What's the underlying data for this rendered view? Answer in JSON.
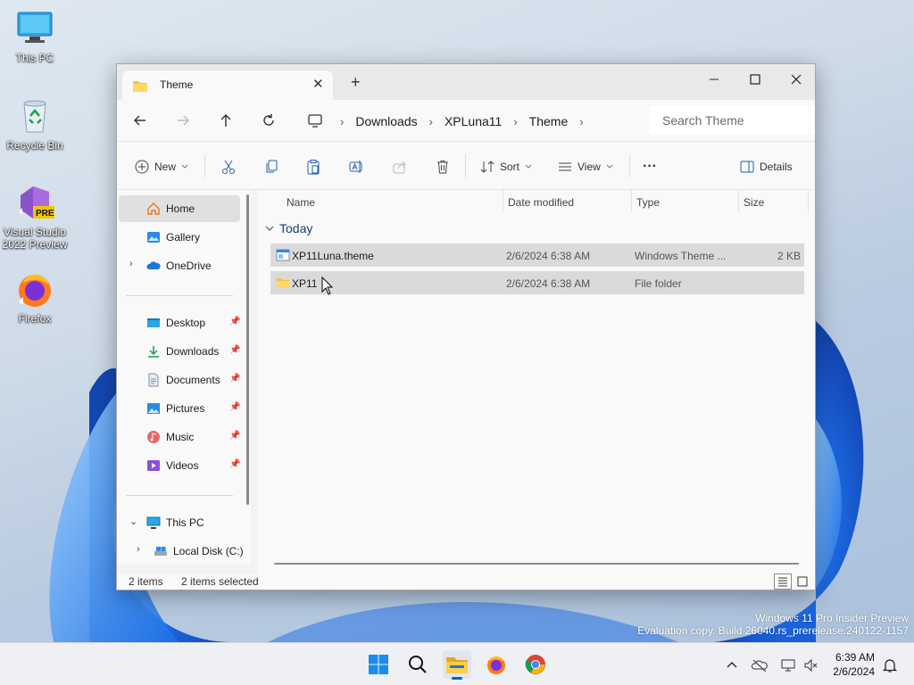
{
  "desktop": {
    "icons": [
      {
        "label": "This PC"
      },
      {
        "label": "Recycle Bin"
      },
      {
        "label": "Visual Studio 2022 Preview"
      },
      {
        "label": "Firefox"
      }
    ],
    "vs_badge": "PRE"
  },
  "window": {
    "tab_title": "Theme",
    "tab_close": "✕",
    "new_tab": "+",
    "controls": {
      "minimize": "—",
      "maximize": "☐",
      "close": "✕"
    },
    "address": {
      "crumbs": [
        "Downloads",
        "XPLuna11",
        "Theme"
      ],
      "search_placeholder": "Search Theme"
    },
    "toolbar": {
      "new_label": "New",
      "sort_label": "Sort",
      "view_label": "View",
      "more_label": "···",
      "details_label": "Details"
    },
    "sidebar": {
      "items": [
        {
          "label": "Home"
        },
        {
          "label": "Gallery"
        },
        {
          "label": "OneDrive"
        },
        {
          "label": "Desktop"
        },
        {
          "label": "Downloads"
        },
        {
          "label": "Documents"
        },
        {
          "label": "Pictures"
        },
        {
          "label": "Music"
        },
        {
          "label": "Videos"
        },
        {
          "label": "This PC"
        },
        {
          "label": "Local Disk (C:)"
        }
      ]
    },
    "columns": [
      "Name",
      "Date modified",
      "Type",
      "Size"
    ],
    "group_label": "Today",
    "files": [
      {
        "name": "XP11Luna.theme",
        "date": "2/6/2024 6:38 AM",
        "type": "Windows Theme ...",
        "size": "2 KB"
      },
      {
        "name": "XP11",
        "date": "2/6/2024 6:38 AM",
        "type": "File folder",
        "size": ""
      }
    ],
    "status": {
      "count": "2 items",
      "selected": "2 items selected"
    }
  },
  "watermark": {
    "line1": "Windows 11 Pro Insider Preview",
    "line2": "Evaluation copy. Build 26040.rs_prerelease.240122-1157"
  },
  "clock": {
    "time": "6:39 AM",
    "date": "2/6/2024"
  },
  "colors": {
    "accent": "#0067c0",
    "folder": "#f6c342",
    "selection": "#dadada"
  }
}
